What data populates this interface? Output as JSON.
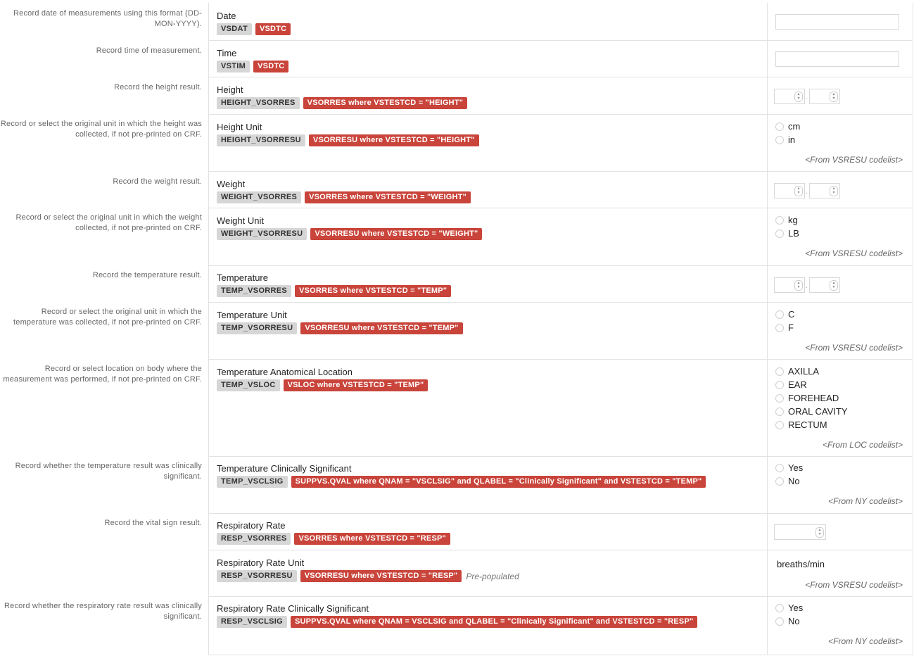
{
  "fields": [
    {
      "instruction": "Record date of measurements using this format (DD-MON-YYYY).",
      "label": "Date",
      "var": "VSDAT",
      "map": "VSDTC"
    },
    {
      "instruction": "Record time of measurement.",
      "label": "Time",
      "var": "VSTIM",
      "map": "VSDTC"
    },
    {
      "instruction": "Record the height result.",
      "label": "Height",
      "var": "HEIGHT_VSORRES",
      "map": "VSORRES where VSTESTCD = \"HEIGHT\""
    },
    {
      "instruction": "Record or select the original unit in which the height was collected, if not pre-printed on CRF.",
      "label": "Height Unit",
      "var": "HEIGHT_VSORRESU",
      "map": "VSORRESU where VSTESTCD = \"HEIGHT\"",
      "options": [
        "cm",
        "in"
      ],
      "codelist": "<From VSRESU codelist>"
    },
    {
      "instruction": "Record the weight result.",
      "label": "Weight",
      "var": "WEIGHT_VSORRES",
      "map": "VSORRES where VSTESTCD = \"WEIGHT\""
    },
    {
      "instruction": "Record or select the original unit in which the weight collected, if not pre-printed on CRF.",
      "label": "Weight Unit",
      "var": "WEIGHT_VSORRESU",
      "map": "VSORRESU where VSTESTCD = \"WEIGHT\"",
      "options": [
        "kg",
        "LB"
      ],
      "codelist": "<From VSRESU codelist>"
    },
    {
      "instruction": "Record the temperature result.",
      "label": "Temperature",
      "var": "TEMP_VSORRES",
      "map": "VSORRES where VSTESTCD = \"TEMP\""
    },
    {
      "instruction": "Record or select the original unit in which the temperature was collected, if not pre-printed on CRF.",
      "label": "Temperature Unit",
      "var": "TEMP_VSORRESU",
      "map": "VSORRESU where VSTESTCD = \"TEMP\"",
      "options": [
        "C",
        "F"
      ],
      "codelist": "<From VSRESU codelist>"
    },
    {
      "instruction": "Record or select location on body where the measurement was performed, if not pre-printed on CRF.",
      "label": "Temperature Anatomical Location",
      "var": "TEMP_VSLOC",
      "map": "VSLOC where VSTESTCD = \"TEMP\"",
      "options": [
        "AXILLA",
        "EAR",
        "FOREHEAD",
        "ORAL CAVITY",
        "RECTUM"
      ],
      "codelist": "<From LOC codelist>"
    },
    {
      "instruction": "Record whether the temperature result was clinically significant.",
      "label": "Temperature Clinically Significant",
      "var": "TEMP_VSCLSIG",
      "map": "SUPPVS.QVAL where QNAM = \"VSCLSIG\" and QLABEL = \"Clinically Significant\" and VSTESTCD = \"TEMP\"",
      "options": [
        "Yes",
        "No"
      ],
      "codelist": "<From NY codelist>"
    },
    {
      "instruction": "Record the vital sign result.",
      "label": "Respiratory Rate",
      "var": "RESP_VSORRES",
      "map": "VSORRES where VSTESTCD = \"RESP\""
    },
    {
      "instruction": "",
      "label": "Respiratory Rate Unit",
      "var": "RESP_VSORRESU",
      "map": "VSORRESU where VSTESTCD = \"RESP\"",
      "note": "Pre-populated",
      "value": "breaths/min",
      "codelist": "<From VSRESU codelist>"
    },
    {
      "instruction": "Record whether the respiratory rate result was clinically significant.",
      "label": "Respiratory Rate Clinically Significant",
      "var": "RESP_VSCLSIG",
      "map": "SUPPVS.QVAL where QNAM = VSCLSIG and QLABEL = \"Clinically Significant\" and VSTESTCD = \"RESP\"",
      "options": [
        "Yes",
        "No"
      ],
      "codelist": "<From NY codelist>"
    }
  ]
}
